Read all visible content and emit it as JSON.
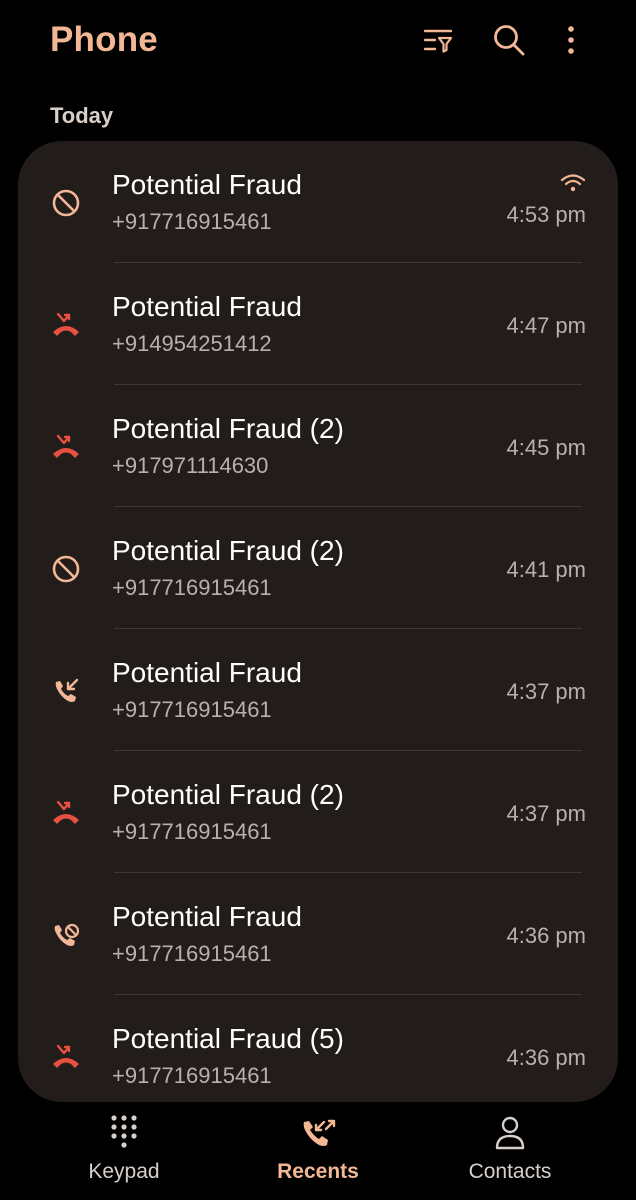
{
  "header": {
    "title": "Phone",
    "icons": [
      "filter-icon",
      "search-icon",
      "more-options-icon"
    ]
  },
  "section": {
    "label": "Today"
  },
  "colors": {
    "accent": "#f4b796",
    "missed": "#e8503f",
    "card": "#221d1b"
  },
  "calls": [
    {
      "type": "blocked",
      "name": "Potential Fraud",
      "number": "+917716915461",
      "time": "4:53 pm",
      "hd": true
    },
    {
      "type": "missed",
      "name": "Potential Fraud",
      "number": "+914954251412",
      "time": "4:47 pm",
      "hd": false
    },
    {
      "type": "missed",
      "name": "Potential Fraud (2)",
      "number": "+917971114630",
      "time": "4:45 pm",
      "hd": false
    },
    {
      "type": "blocked",
      "name": "Potential Fraud (2)",
      "number": "+917716915461",
      "time": "4:41 pm",
      "hd": false
    },
    {
      "type": "incoming",
      "name": "Potential Fraud",
      "number": "+917716915461",
      "time": "4:37 pm",
      "hd": false
    },
    {
      "type": "missed",
      "name": "Potential Fraud (2)",
      "number": "+917716915461",
      "time": "4:37 pm",
      "hd": false
    },
    {
      "type": "rejected",
      "name": "Potential Fraud",
      "number": "+917716915461",
      "time": "4:36 pm",
      "hd": false
    },
    {
      "type": "missed",
      "name": "Potential Fraud (5)",
      "number": "+917716915461",
      "time": "4:36 pm",
      "hd": false
    }
  ],
  "nav": [
    {
      "label": "Keypad",
      "icon": "keypad-icon",
      "active": false
    },
    {
      "label": "Recents",
      "icon": "recents-icon",
      "active": true
    },
    {
      "label": "Contacts",
      "icon": "contacts-icon",
      "active": false
    }
  ]
}
